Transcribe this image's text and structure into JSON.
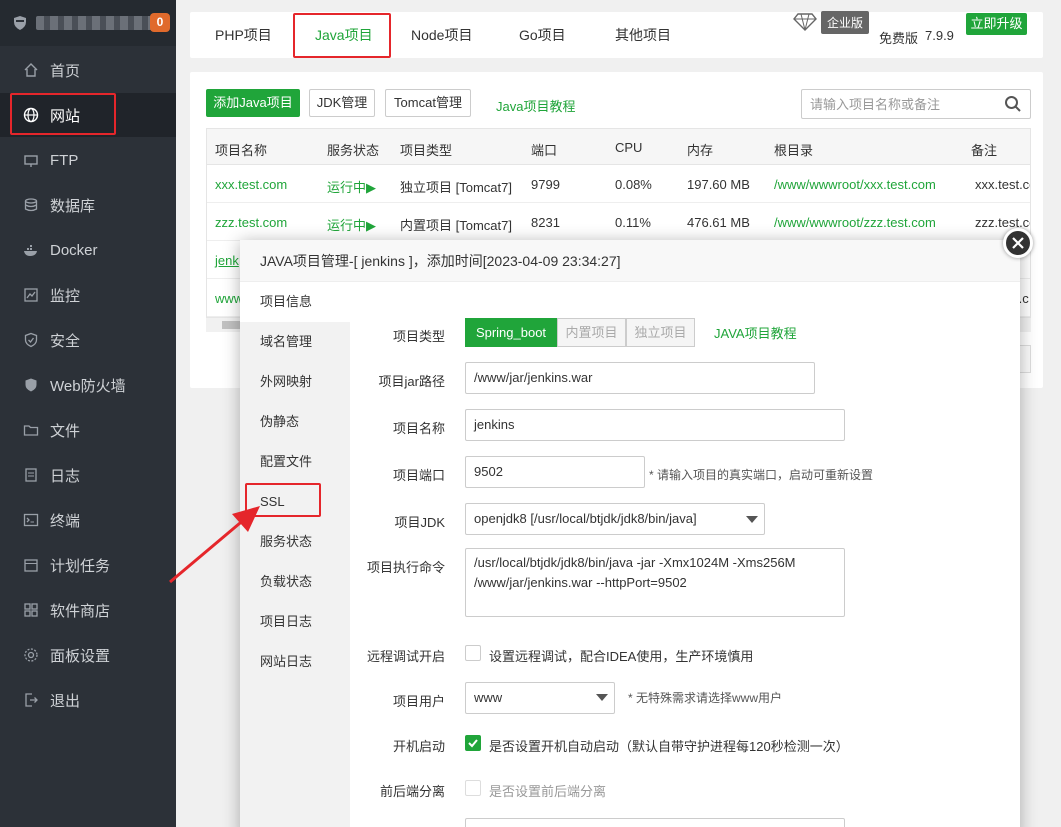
{
  "sidebar": {
    "badge": "0",
    "items": [
      {
        "label": "首页",
        "icon": "home-icon"
      },
      {
        "label": "网站",
        "icon": "globe-icon"
      },
      {
        "label": "FTP",
        "icon": "ftp-icon"
      },
      {
        "label": "数据库",
        "icon": "database-icon"
      },
      {
        "label": "Docker",
        "icon": "docker-icon"
      },
      {
        "label": "监控",
        "icon": "monitor-icon"
      },
      {
        "label": "安全",
        "icon": "shield-icon"
      },
      {
        "label": "Web防火墙",
        "icon": "firewall-icon"
      },
      {
        "label": "文件",
        "icon": "folder-icon"
      },
      {
        "label": "日志",
        "icon": "log-icon"
      },
      {
        "label": "终端",
        "icon": "terminal-icon"
      },
      {
        "label": "计划任务",
        "icon": "calendar-icon"
      },
      {
        "label": "软件商店",
        "icon": "apps-icon"
      },
      {
        "label": "面板设置",
        "icon": "gear-icon"
      },
      {
        "label": "退出",
        "icon": "logout-icon"
      }
    ]
  },
  "tabs": [
    "PHP项目",
    "Java项目",
    "Node项目",
    "Go项目",
    "其他项目"
  ],
  "edition": {
    "enterprise": "企业版",
    "free": "免费版",
    "version": "7.9.9",
    "upgrade": "立即升级"
  },
  "toolbar": {
    "add": "添加Java项目",
    "jdk": "JDK管理",
    "tomcat": "Tomcat管理",
    "tutorial": "Java项目教程",
    "search_placeholder": "请输入项目名称或备注"
  },
  "table": {
    "headers": [
      "项目名称",
      "服务状态",
      "项目类型",
      "端口",
      "CPU",
      "内存",
      "根目录",
      "备注"
    ],
    "rows": [
      [
        "xxx.test.com",
        "运行中▶",
        "独立项目 [Tomcat7]",
        "9799",
        "0.08%",
        "197.60 MB",
        "/www/wwwroot/xxx.test.com",
        "xxx.test.co"
      ],
      [
        "zzz.test.com",
        "运行中▶",
        "内置项目 [Tomcat7]",
        "8231",
        "0.11%",
        "476.61 MB",
        "/www/wwwroot/zzz.test.com",
        "zzz.test.co"
      ],
      [
        "jenk"
      ],
      [
        "www",
        "",
        "",
        "",
        "",
        "",
        "",
        "t.c"
      ]
    ]
  },
  "dialog": {
    "title": "JAVA项目管理-[ jenkins ]，添加时间[2023-04-09 23:34:27]",
    "menu": [
      "项目信息",
      "域名管理",
      "外网映射",
      "伪静态",
      "配置文件",
      "SSL",
      "服务状态",
      "负载状态",
      "项目日志",
      "网站日志"
    ],
    "form": {
      "type_label": "项目类型",
      "type_options": [
        "Spring_boot",
        "内置项目",
        "独立项目"
      ],
      "tutorial": "JAVA项目教程",
      "jar_label": "项目jar路径",
      "jar_value": "/www/jar/jenkins.war",
      "name_label": "项目名称",
      "name_value": "jenkins",
      "port_label": "项目端口",
      "port_value": "9502",
      "port_hint": "* 请输入项目的真实端口，启动可重新设置",
      "jdk_label": "项目JDK",
      "jdk_value": "openjdk8 [/usr/local/btjdk/jdk8/bin/java]",
      "cmd_label": "项目执行命令",
      "cmd_value": "/usr/local/btjdk/jdk8/bin/java -jar -Xmx1024M -Xms256M /www/jar/jenkins.war --httpPort=9502",
      "debug_label": "远程调试开启",
      "debug_text": "设置远程调试，配合IDEA使用，生产环境慎用",
      "user_label": "项目用户",
      "user_value": "www",
      "user_hint": "* 无特殊需求请选择www用户",
      "boot_label": "开机启动",
      "boot_text": "是否设置开机自动启动（默认自带守护进程每120秒检测一次）",
      "split_label": "前后端分离",
      "split_text": "是否设置前后端分离"
    }
  },
  "colors": {
    "brand": "#20a53a",
    "highlight": "#e5262b",
    "sidebar_bg": "#2c3138"
  }
}
